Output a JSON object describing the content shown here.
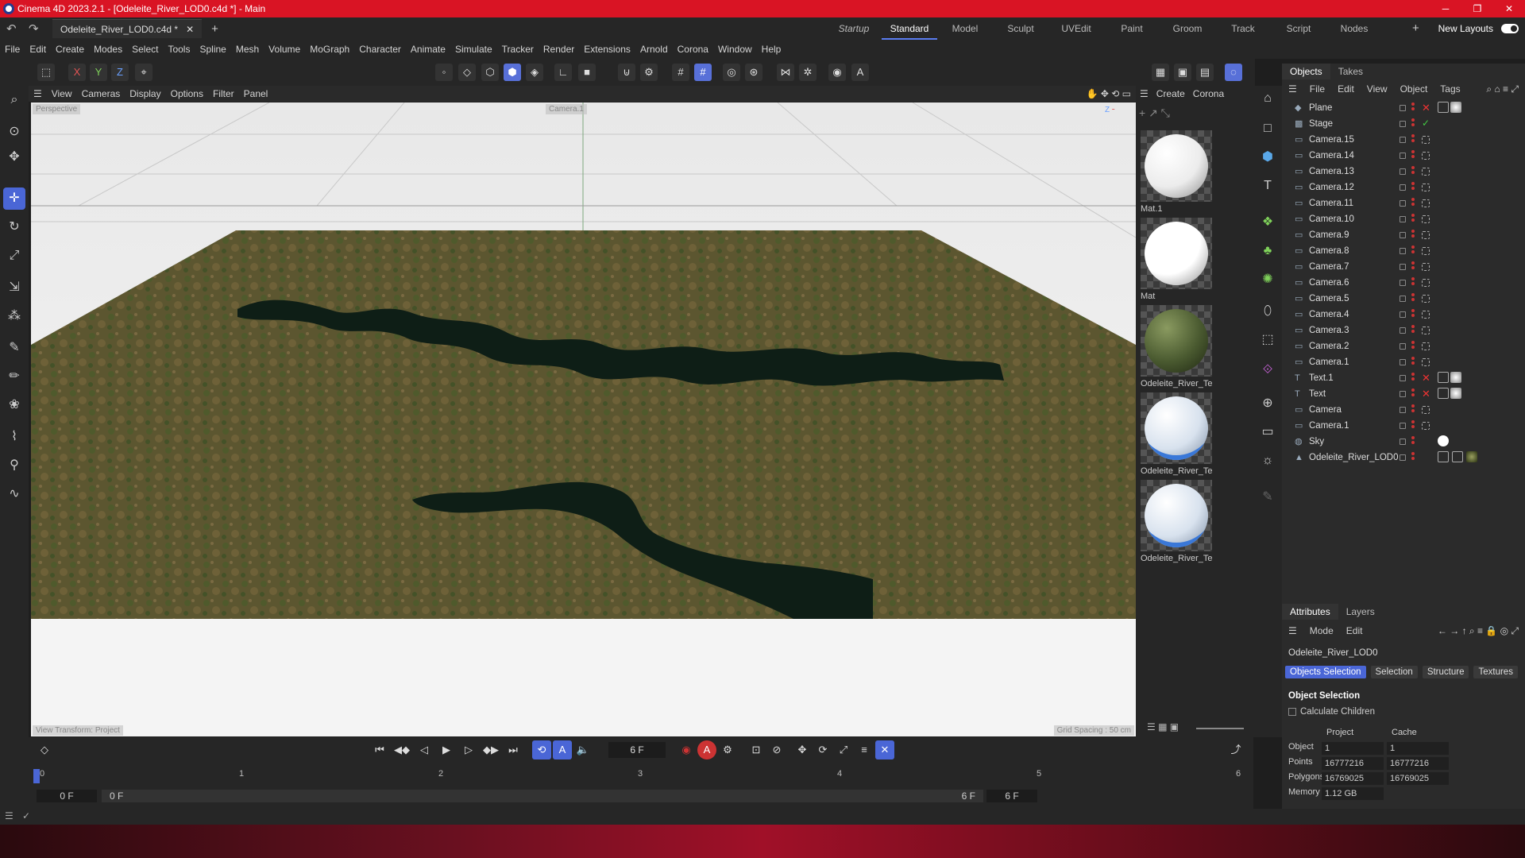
{
  "window": {
    "title": "Cinema 4D 2023.2.1 - [Odeleite_River_LOD0.c4d *] - Main",
    "controls": [
      "─",
      "❐",
      "✕"
    ]
  },
  "doc_tab": {
    "name": "Odeleite_River_LOD0.c4d *",
    "close": "✕"
  },
  "layouts": {
    "items": [
      "Startup",
      "Standard",
      "Model",
      "Sculpt",
      "UVEdit",
      "Paint",
      "Groom",
      "Track",
      "Script",
      "Nodes"
    ],
    "active": "Standard",
    "new_layouts": "New Layouts"
  },
  "menu": [
    "File",
    "Edit",
    "Create",
    "Modes",
    "Select",
    "Tools",
    "Spline",
    "Mesh",
    "Volume",
    "MoGraph",
    "Character",
    "Animate",
    "Simulate",
    "Tracker",
    "Render",
    "Extensions",
    "Arnold",
    "Corona",
    "Window",
    "Help"
  ],
  "axis_lock": [
    "X",
    "Y",
    "Z"
  ],
  "viewport_menu": [
    "View",
    "Cameras",
    "Display",
    "Options",
    "Filter",
    "Panel"
  ],
  "viewport": {
    "camera_label": "Perspective",
    "camera_name": "Camera.1",
    "left_hud": "View Transform: Project",
    "right_hud": "Grid Spacing : 50 cm"
  },
  "materials_menu": [
    "Create",
    "Corona"
  ],
  "materials": [
    {
      "label": "Mat.1",
      "color": "#ececec"
    },
    {
      "label": "Mat",
      "color": "#ffffff"
    },
    {
      "label": "Odeleite_River_Te:",
      "color": "#4a5a30"
    },
    {
      "label": "Odeleite_River_Te:",
      "color": "#d8e2ee"
    },
    {
      "label": "Odeleite_River_Te:",
      "color": "#d8e2ee"
    }
  ],
  "objects_panel": {
    "tabs": [
      "Objects",
      "Takes"
    ],
    "menu": [
      "File",
      "Edit",
      "View",
      "Object",
      "Tags"
    ],
    "items": [
      {
        "name": "Plane",
        "icon": "plane-icon"
      },
      {
        "name": "Stage",
        "icon": "stage-icon"
      },
      {
        "name": "Camera.15",
        "icon": "camera-icon"
      },
      {
        "name": "Camera.14",
        "icon": "camera-icon"
      },
      {
        "name": "Camera.13",
        "icon": "camera-icon"
      },
      {
        "name": "Camera.12",
        "icon": "camera-icon"
      },
      {
        "name": "Camera.11",
        "icon": "camera-icon"
      },
      {
        "name": "Camera.10",
        "icon": "camera-icon"
      },
      {
        "name": "Camera.9",
        "icon": "camera-icon"
      },
      {
        "name": "Camera.8",
        "icon": "camera-icon"
      },
      {
        "name": "Camera.7",
        "icon": "camera-icon"
      },
      {
        "name": "Camera.6",
        "icon": "camera-icon"
      },
      {
        "name": "Camera.5",
        "icon": "camera-icon"
      },
      {
        "name": "Camera.4",
        "icon": "camera-icon"
      },
      {
        "name": "Camera.3",
        "icon": "camera-icon"
      },
      {
        "name": "Camera.2",
        "icon": "camera-icon"
      },
      {
        "name": "Camera.1",
        "icon": "camera-icon"
      },
      {
        "name": "Text.1",
        "icon": "text-icon"
      },
      {
        "name": "Text",
        "icon": "text-icon"
      },
      {
        "name": "Camera",
        "icon": "camera-icon"
      },
      {
        "name": "Camera.1",
        "icon": "camera-icon"
      },
      {
        "name": "Sky",
        "icon": "sky-icon"
      },
      {
        "name": "Odeleite_River_LOD0",
        "icon": "mesh-icon"
      }
    ]
  },
  "attributes": {
    "tabs": [
      "Attributes",
      "Layers"
    ],
    "menu": [
      "Mode",
      "Edit"
    ],
    "object_name": "Odeleite_River_LOD0",
    "sub_tabs": [
      "Objects Selection",
      "Selection",
      "Structure",
      "Textures"
    ],
    "section": "Object Selection",
    "calc_children": "Calculate Children",
    "col_project": "Project",
    "col_cache": "Cache",
    "rows": [
      {
        "label": "Object",
        "project": "1",
        "cache": "1"
      },
      {
        "label": "Points",
        "project": "16777216",
        "cache": "16777216"
      },
      {
        "label": "Polygons",
        "project": "16769025",
        "cache": "16769025"
      },
      {
        "label": "Memory",
        "project": "1.12 GB",
        "cache": ""
      }
    ]
  },
  "timeline": {
    "current_frame": "6 F",
    "start": "0 F",
    "start2": "0 F",
    "end": "6 F",
    "end2": "6 F",
    "ticks": [
      "0",
      "1",
      "2",
      "3",
      "4",
      "5",
      "6"
    ],
    "playhead_frame": 0
  }
}
